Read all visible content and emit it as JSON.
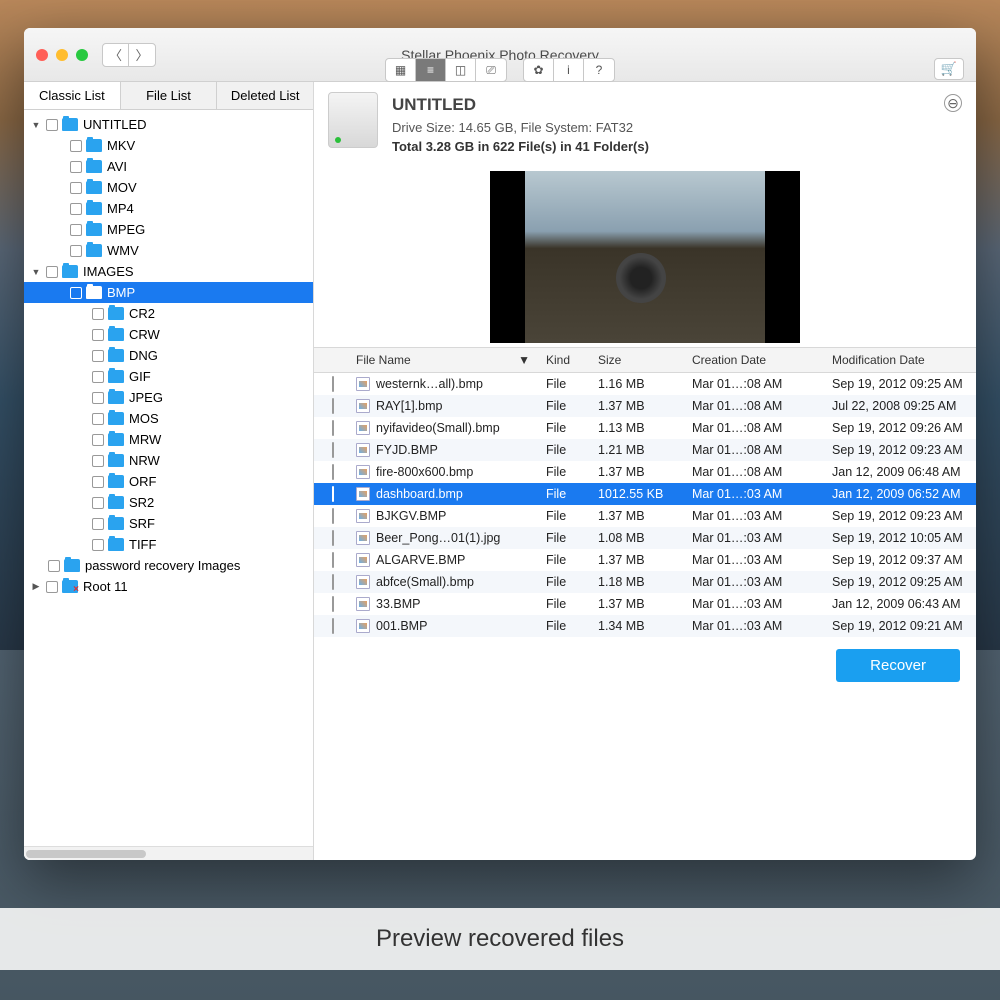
{
  "window_title": "Stellar Phoenix Photo Recovery",
  "caption": "Preview recovered files",
  "toolbar": {
    "view_icons": [
      "grid",
      "list",
      "columns",
      "coverflow"
    ],
    "util_icons": [
      "gear",
      "info",
      "help"
    ],
    "cart_icon": "cart"
  },
  "sidebar": {
    "tabs": [
      "Classic List",
      "File List",
      "Deleted List"
    ],
    "active_tab": 0,
    "tree": [
      {
        "depth": 0,
        "arrow": "▼",
        "label": "UNTITLED"
      },
      {
        "depth": 1,
        "label": "MKV"
      },
      {
        "depth": 1,
        "label": "AVI"
      },
      {
        "depth": 1,
        "label": "MOV"
      },
      {
        "depth": 1,
        "label": "MP4"
      },
      {
        "depth": 1,
        "label": "MPEG"
      },
      {
        "depth": 1,
        "label": "WMV"
      },
      {
        "depth": 0,
        "arrow": "▼",
        "label": "IMAGES"
      },
      {
        "depth": 1,
        "label": "BMP",
        "selected": true
      },
      {
        "depth": 2,
        "label": "CR2"
      },
      {
        "depth": 2,
        "label": "CRW"
      },
      {
        "depth": 2,
        "label": "DNG"
      },
      {
        "depth": 2,
        "label": "GIF"
      },
      {
        "depth": 2,
        "label": "JPEG"
      },
      {
        "depth": 2,
        "label": "MOS"
      },
      {
        "depth": 2,
        "label": "MRW"
      },
      {
        "depth": 2,
        "label": "NRW"
      },
      {
        "depth": 2,
        "label": "ORF"
      },
      {
        "depth": 2,
        "label": "SR2"
      },
      {
        "depth": 2,
        "label": "SRF"
      },
      {
        "depth": 2,
        "label": "TIFF"
      },
      {
        "depth": 0,
        "label": "password recovery Images"
      },
      {
        "depth": 0,
        "arrow": "▶",
        "label": "Root 11",
        "red": true
      }
    ]
  },
  "drive": {
    "name": "UNTITLED",
    "meta": "Drive Size: 14.65 GB, File System: FAT32",
    "total": "Total 3.28 GB in 622 File(s) in 41 Folder(s)"
  },
  "columns": [
    "File Name",
    "Kind",
    "Size",
    "Creation Date",
    "Modification Date"
  ],
  "sort_indicator": "▼",
  "files": [
    {
      "name": "westernk…all).bmp",
      "kind": "File",
      "size": "1.16 MB",
      "cdate": "Mar 01…:08 AM",
      "mdate": "Sep 19, 2012 09:25 AM"
    },
    {
      "name": "RAY[1].bmp",
      "kind": "File",
      "size": "1.37 MB",
      "cdate": "Mar 01…:08 AM",
      "mdate": "Jul 22, 2008 09:25 AM"
    },
    {
      "name": "nyifavideo(Small).bmp",
      "kind": "File",
      "size": "1.13 MB",
      "cdate": "Mar 01…:08 AM",
      "mdate": "Sep 19, 2012 09:26 AM"
    },
    {
      "name": "FYJD.BMP",
      "kind": "File",
      "size": "1.21 MB",
      "cdate": "Mar 01…:08 AM",
      "mdate": "Sep 19, 2012 09:23 AM"
    },
    {
      "name": "fire-800x600.bmp",
      "kind": "File",
      "size": "1.37 MB",
      "cdate": "Mar 01…:08 AM",
      "mdate": "Jan 12, 2009 06:48 AM"
    },
    {
      "name": "dashboard.bmp",
      "kind": "File",
      "size": "1012.55 KB",
      "cdate": "Mar 01…:03 AM",
      "mdate": "Jan 12, 2009 06:52 AM",
      "selected": true
    },
    {
      "name": "BJKGV.BMP",
      "kind": "File",
      "size": "1.37 MB",
      "cdate": "Mar 01…:03 AM",
      "mdate": "Sep 19, 2012 09:23 AM"
    },
    {
      "name": "Beer_Pong…01(1).jpg",
      "kind": "File",
      "size": "1.08 MB",
      "cdate": "Mar 01…:03 AM",
      "mdate": "Sep 19, 2012 10:05 AM"
    },
    {
      "name": "ALGARVE.BMP",
      "kind": "File",
      "size": "1.37 MB",
      "cdate": "Mar 01…:03 AM",
      "mdate": "Sep 19, 2012 09:37 AM"
    },
    {
      "name": "abfce(Small).bmp",
      "kind": "File",
      "size": "1.18 MB",
      "cdate": "Mar 01…:03 AM",
      "mdate": "Sep 19, 2012 09:25 AM"
    },
    {
      "name": "33.BMP",
      "kind": "File",
      "size": "1.37 MB",
      "cdate": "Mar 01…:03 AM",
      "mdate": "Jan 12, 2009 06:43 AM"
    },
    {
      "name": "001.BMP",
      "kind": "File",
      "size": "1.34 MB",
      "cdate": "Mar 01…:03 AM",
      "mdate": "Sep 19, 2012 09:21 AM"
    }
  ],
  "recover_label": "Recover"
}
